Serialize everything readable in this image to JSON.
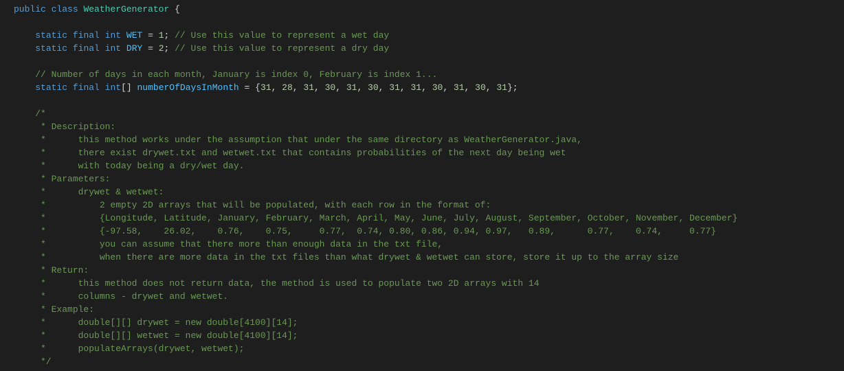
{
  "code": {
    "line1": {
      "kw_public": "public",
      "kw_class": "class",
      "classname": "WeatherGenerator",
      "brace": " {"
    },
    "line3": {
      "indent": "    ",
      "kw_static": "static",
      "kw_final": "final",
      "type": "int",
      "name": "WET",
      "eq": " = ",
      "val": "1",
      "semi": ";",
      "comment": " // Use this value to represent a wet day"
    },
    "line4": {
      "indent": "    ",
      "kw_static": "static",
      "kw_final": "final",
      "type": "int",
      "name": "DRY",
      "eq": " = ",
      "val": "2",
      "semi": ";",
      "comment": " // Use this value to represent a dry day"
    },
    "line6": {
      "indent": "    ",
      "comment": "// Number of days in each month, January is index 0, February is index 1..."
    },
    "line7": {
      "indent": "    ",
      "kw_static": "static",
      "kw_final": "final",
      "type": "int",
      "brackets": "[]",
      "name": "numberOfDaysInMonth",
      "eq": " = ",
      "open": "{",
      "v1": "31",
      "c1": ", ",
      "v2": "28",
      "c2": ", ",
      "v3": "31",
      "c3": ", ",
      "v4": "30",
      "c4": ", ",
      "v5": "31",
      "c5": ", ",
      "v6": "30",
      "c6": ", ",
      "v7": "31",
      "c7": ", ",
      "v8": "31",
      "c8": ", ",
      "v9": "30",
      "c9": ", ",
      "v10": "31",
      "c10": ", ",
      "v11": "30",
      "c11": ", ",
      "v12": "31",
      "close": "};"
    },
    "blk": {
      "l1": "    /*",
      "l2": "     * Description:",
      "l3": "     *      this method works under the assumption that under the same directory as WeatherGenerator.java,",
      "l4": "     *      there exist drywet.txt and wetwet.txt that contains probabilities of the next day being wet",
      "l5": "     *      with today being a dry/wet day.",
      "l6": "     * Parameters:",
      "l7": "     *      drywet & wetwet:",
      "l8": "     *          2 empty 2D arrays that will be populated, with each row in the format of:",
      "l9": "     *          {Longitude, Latitude, January, February, March, April, May, June, July, August, September, October, November, December}",
      "l10": "     *          {-97.58,    26.02,    0.76,    0.75,     0.77,  0.74, 0.80, 0.86, 0.94, 0.97,   0.89,      0.77,    0.74,     0.77}",
      "l11": "     *          you can assume that there more than enough data in the txt file,",
      "l12": "     *          when there are more data in the txt files than what drywet & wetwet can store, store it up to the array size",
      "l13": "     * Return:",
      "l14": "     *      this method does not return data, the method is used to populate two 2D arrays with 14 ",
      "l15": "     *      columns - drywet and wetwet.",
      "l16": "     * Example:",
      "l17": "     *      double[][] drywet = new double[4100][14];",
      "l18": "     *      double[][] wetwet = new double[4100][14];",
      "l19": "     *      populateArrays(drywet, wetwet);",
      "l20": "     */"
    }
  }
}
